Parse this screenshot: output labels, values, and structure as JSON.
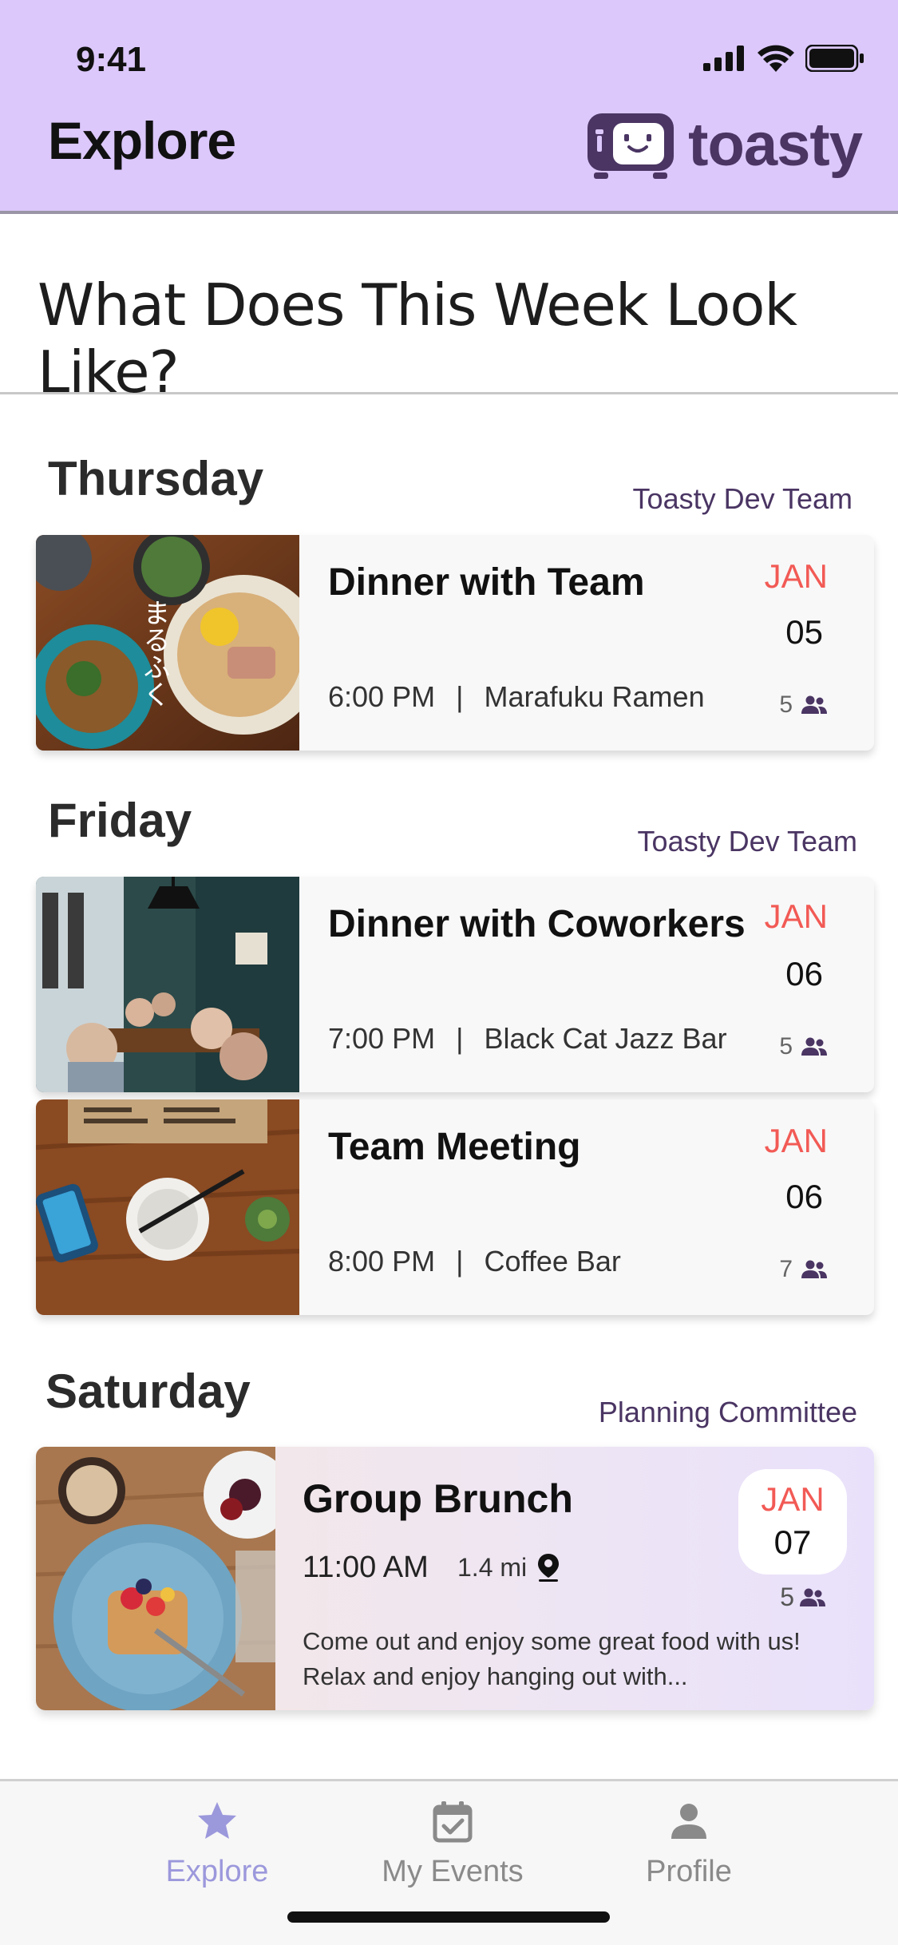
{
  "status": {
    "time": "9:41"
  },
  "header": {
    "title": "Explore",
    "brand": "toasty"
  },
  "week": {
    "title": "What Does This Week Look Like?"
  },
  "days": [
    {
      "day": "Thursday",
      "group": "Toasty Dev Team",
      "events": [
        {
          "title": "Dinner with Team",
          "time": "6:00 PM",
          "sep": "|",
          "place": "Marafuku Ramen",
          "month": "JAN",
          "date": "05",
          "count": "5"
        }
      ]
    },
    {
      "day": "Friday",
      "group": "Toasty Dev Team",
      "events": [
        {
          "title": "Dinner with Coworkers",
          "time": "7:00 PM",
          "sep": "|",
          "place": "Black Cat Jazz Bar",
          "month": "JAN",
          "date": "06",
          "count": "5"
        },
        {
          "title": "Team Meeting",
          "time": "8:00 PM",
          "sep": "|",
          "place": "Coffee Bar",
          "month": "JAN",
          "date": "06",
          "count": "7"
        }
      ]
    },
    {
      "day": "Saturday",
      "group": "Planning Committee",
      "featured": {
        "title": "Group Brunch",
        "time": "11:00 AM",
        "distance": "1.4 mi",
        "description": "Come out and enjoy some great food with us! Relax and enjoy hanging out with...",
        "month": "JAN",
        "date": "07",
        "count": "5"
      }
    }
  ],
  "tabs": [
    {
      "label": "Explore",
      "icon": "star-icon",
      "active": true
    },
    {
      "label": "My Events",
      "icon": "calendar-check-icon",
      "active": false
    },
    {
      "label": "Profile",
      "icon": "person-icon",
      "active": false
    }
  ],
  "colors": {
    "header_bg": "#dcc8fb",
    "brand": "#4a3563",
    "month": "#f25a55",
    "tab_active": "#9c98dc"
  }
}
